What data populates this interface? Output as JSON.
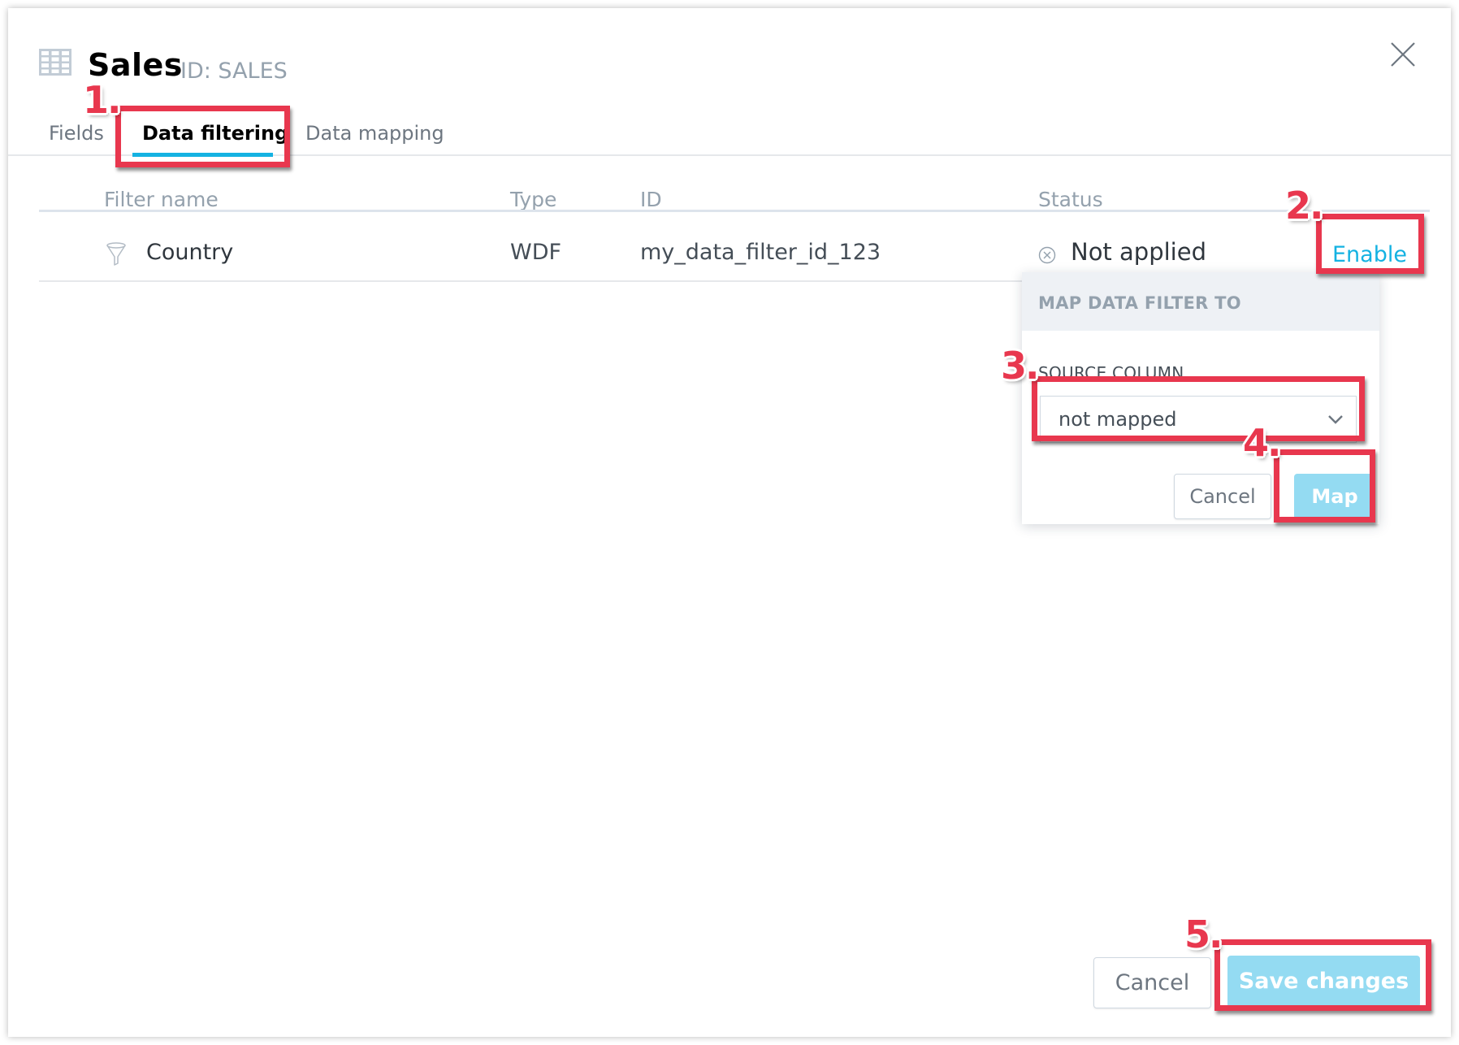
{
  "dialog": {
    "title": "Sales",
    "id_label": "ID: SALES",
    "icons": {
      "dataset": "table-icon",
      "close": "close-icon"
    }
  },
  "tabs": [
    {
      "label": "Fields",
      "active": false
    },
    {
      "label": "Data filtering",
      "active": true
    },
    {
      "label": "Data mapping",
      "active": false
    }
  ],
  "table": {
    "columns": [
      "Filter name",
      "Type",
      "ID",
      "Status"
    ],
    "rows": [
      {
        "icon": "funnel-icon",
        "name": "Country",
        "type": "WDF",
        "id": "my_data_filter_id_123",
        "status_icon": "not-applied-icon",
        "status": "Not applied",
        "action": "Enable"
      }
    ]
  },
  "popover": {
    "title": "MAP DATA FILTER TO",
    "source_label": "SOURCE COLUMN",
    "select_value": "not mapped",
    "cancel_label": "Cancel",
    "map_label": "Map"
  },
  "footer": {
    "cancel_label": "Cancel",
    "save_label": "Save changes"
  },
  "annotations": [
    "1.",
    "2.",
    "3.",
    "4.",
    "5."
  ],
  "colors": {
    "accent": "#14b2e2",
    "primary_disabled": "#94dbf2",
    "annotation": "#e8374e"
  }
}
